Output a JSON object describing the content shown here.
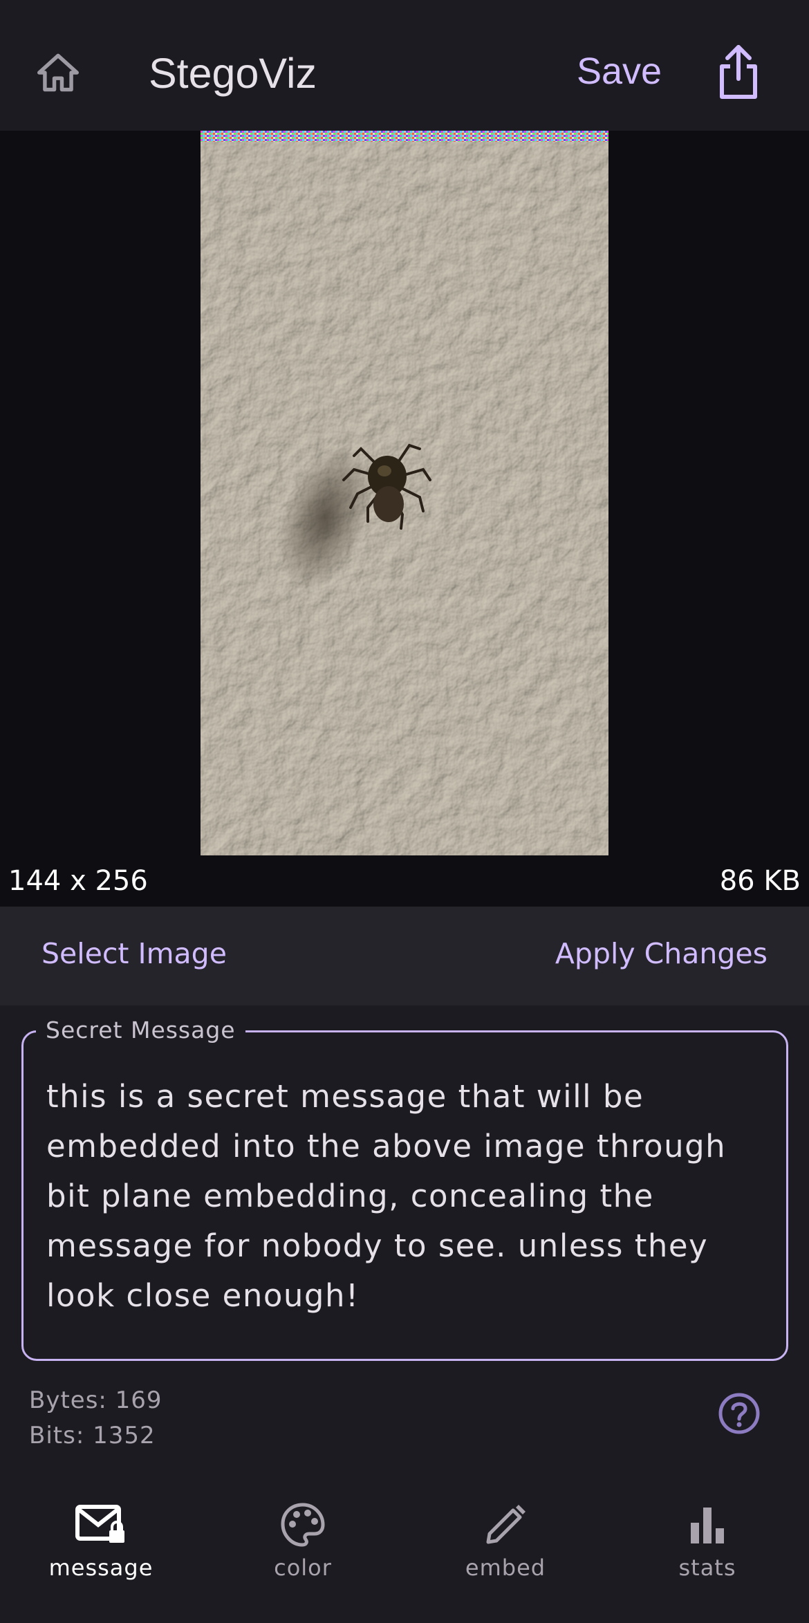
{
  "header": {
    "title": "StegoViz",
    "save_label": "Save"
  },
  "image_info": {
    "dimensions": "144 x 256",
    "file_size": "86 KB"
  },
  "actions": {
    "select_image": "Select Image",
    "apply_changes": "Apply Changes"
  },
  "message": {
    "label": "Secret Message",
    "value": "this is a secret message that will be embedded into the above image through bit plane embedding, concealing the message for nobody to see. unless they look close enough!",
    "bytes": "Bytes: 169",
    "bits": "Bits: 1352"
  },
  "nav": {
    "items": [
      {
        "label": "message",
        "icon": "mail-lock-icon",
        "active": true
      },
      {
        "label": "color",
        "icon": "palette-icon",
        "active": false
      },
      {
        "label": "embed",
        "icon": "pencil-icon",
        "active": false
      },
      {
        "label": "stats",
        "icon": "bar-chart-icon",
        "active": false
      }
    ]
  },
  "colors": {
    "accent": "#d0bcff",
    "background": "#1c1b21",
    "surface": "#25242b"
  }
}
